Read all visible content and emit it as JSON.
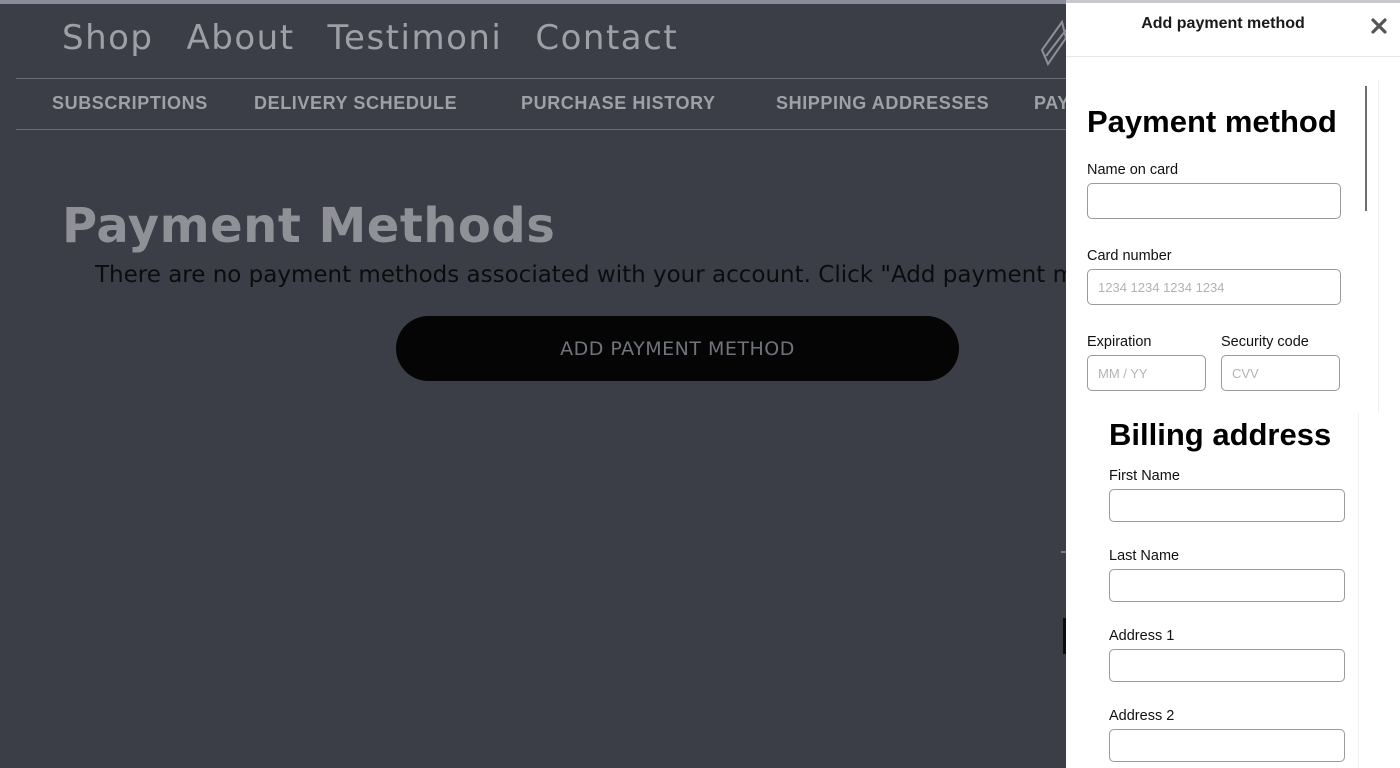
{
  "nav": {
    "main": [
      "Shop",
      "About",
      "Testimoni",
      "Contact"
    ],
    "sub": [
      "SUBSCRIPTIONS",
      "DELIVERY SCHEDULE",
      "PURCHASE HISTORY",
      "SHIPPING ADDRESSES",
      "PAY"
    ]
  },
  "main": {
    "title": "Payment Methods",
    "message": "There are no payment methods associated with your account. Click \"Add payment method\" to add one.",
    "add_button": "ADD PAYMENT METHOD"
  },
  "modal": {
    "title": "Add payment method",
    "close_icon": "close-icon",
    "payment": {
      "heading": "Payment method",
      "name_label": "Name on card",
      "name_value": "",
      "card_label": "Card number",
      "card_placeholder": "1234 1234 1234 1234",
      "exp_label": "Expiration",
      "exp_placeholder": "MM / YY",
      "cvc_label": "Security code",
      "cvc_placeholder": "CVV"
    },
    "billing": {
      "heading": "Billing address",
      "first_label": "First Name",
      "last_label": "Last Name",
      "addr1_label": "Address 1",
      "addr2_label": "Address 2"
    }
  },
  "colors": {
    "overlay_bg": "#3b3e46",
    "button_bg": "#050506",
    "panel_bg": "#ffffff"
  }
}
